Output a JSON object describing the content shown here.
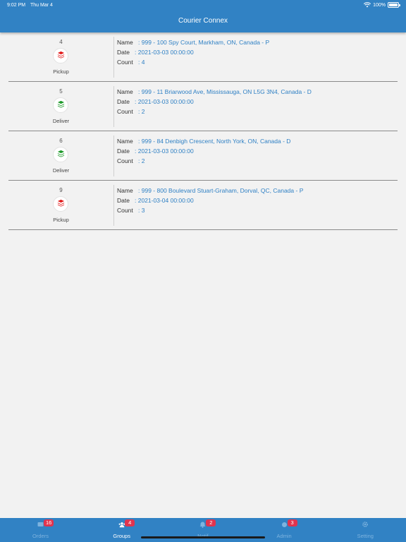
{
  "status_bar": {
    "time": "9:02 PM",
    "date": "Thu Mar 4",
    "battery": "100%"
  },
  "header": {
    "title": "Courier Connex"
  },
  "labels": {
    "name": "Name",
    "date": "Date",
    "count": "Count",
    "sep": ":"
  },
  "orders": [
    {
      "seq": "4",
      "type": "Pickup",
      "type_color": "#e21b1b",
      "name": "999 - 100 Spy Court, Markham, ON, Canada - P",
      "date": "2021-03-03 00:00:00",
      "count": "4"
    },
    {
      "seq": "5",
      "type": "Deliver",
      "type_color": "#1e9a2a",
      "name": "999 - 11 Briarwood Ave, Mississauga, ON L5G 3N4, Canada - D",
      "date": "2021-03-03 00:00:00",
      "count": "2"
    },
    {
      "seq": "6",
      "type": "Deliver",
      "type_color": "#1e9a2a",
      "name": "999 - 84 Denbigh Crescent, North York, ON, Canada - D",
      "date": "2021-03-03 00:00:00",
      "count": "2"
    },
    {
      "seq": "9",
      "type": "Pickup",
      "type_color": "#e21b1b",
      "name": "999 - 800 Boulevard Stuart-Graham, Dorval, QC, Canada - P",
      "date": "2021-03-04 00:00:00",
      "count": "3"
    }
  ],
  "tabs": [
    {
      "label": "Orders",
      "badge": "16",
      "icon": "orders-icon",
      "active": false
    },
    {
      "label": "Groups",
      "badge": "4",
      "icon": "groups-icon",
      "active": true
    },
    {
      "label": "Notif",
      "badge": "2",
      "icon": "bell-icon",
      "active": false
    },
    {
      "label": "Admin",
      "badge": "3",
      "icon": "admin-icon",
      "active": false
    },
    {
      "label": "Setting",
      "badge": "",
      "icon": "gear-icon",
      "active": false
    }
  ],
  "colors": {
    "primary": "#3182c4",
    "link": "#2f80c4",
    "badge": "#e0344f"
  }
}
